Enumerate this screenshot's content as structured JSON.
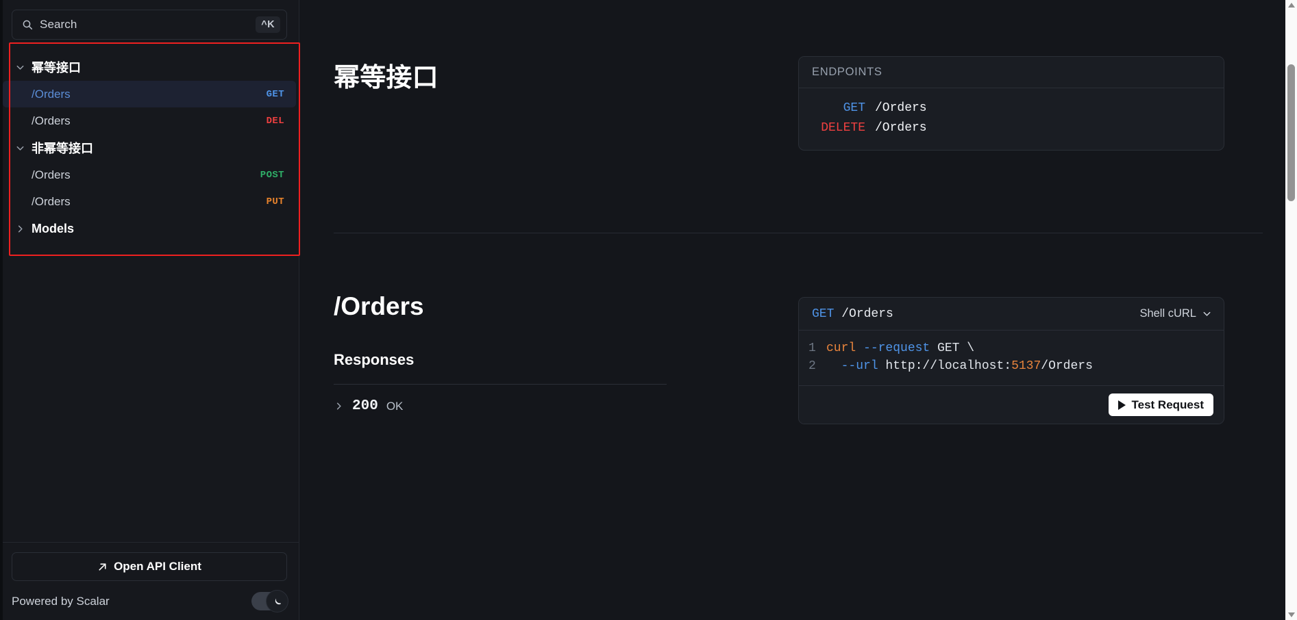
{
  "search": {
    "placeholder": "Search",
    "shortcut": "^K",
    "icon": "search-icon"
  },
  "sidebar": {
    "groups": [
      {
        "label": "幂等接口",
        "expanded": true,
        "items": [
          {
            "path": "/Orders",
            "method": "GET",
            "method_color": "#4f94e8",
            "active": true
          },
          {
            "path": "/Orders",
            "method": "DEL",
            "method_color": "#ef4040",
            "active": false
          }
        ]
      },
      {
        "label": "非幂等接口",
        "expanded": true,
        "items": [
          {
            "path": "/Orders",
            "method": "POST",
            "method_color": "#2faf68",
            "active": false
          },
          {
            "path": "/Orders",
            "method": "PUT",
            "method_color": "#e8832c",
            "active": false
          }
        ]
      }
    ],
    "models_label": "Models",
    "footer": {
      "open_api_client": "Open API Client",
      "powered_by": "Powered by Scalar",
      "theme_toggle_icon": "moon-icon",
      "theme_toggle_state": "dark"
    }
  },
  "main": {
    "section_title": "幂等接口",
    "endpoints_card": {
      "header": "ENDPOINTS",
      "rows": [
        {
          "method": "GET",
          "path": "/Orders",
          "color": "#4f94e8"
        },
        {
          "method": "DELETE",
          "path": "/Orders",
          "color": "#ef4040"
        }
      ]
    },
    "operation": {
      "title": "/Orders",
      "responses_heading": "Responses",
      "responses": [
        {
          "code": "200",
          "text": "OK",
          "expanded": false
        }
      ]
    },
    "code_sample": {
      "method": "GET",
      "path": "/Orders",
      "language": "Shell cURL",
      "lines": [
        {
          "num": "1",
          "cmd": "curl",
          "flag": " --request",
          "plain": " GET \\"
        },
        {
          "num": "2",
          "indent": "  ",
          "flag": "--url",
          "plain": " http://localhost:",
          "num_token": "5137",
          "tail": "/Orders"
        }
      ],
      "test_button": "Test Request"
    }
  },
  "colors": {
    "accent_blue": "#4f94e8",
    "danger_red": "#ef4040",
    "success_green": "#2faf68",
    "warn_orange": "#e8832c",
    "annotation_red": "#ef2020"
  }
}
